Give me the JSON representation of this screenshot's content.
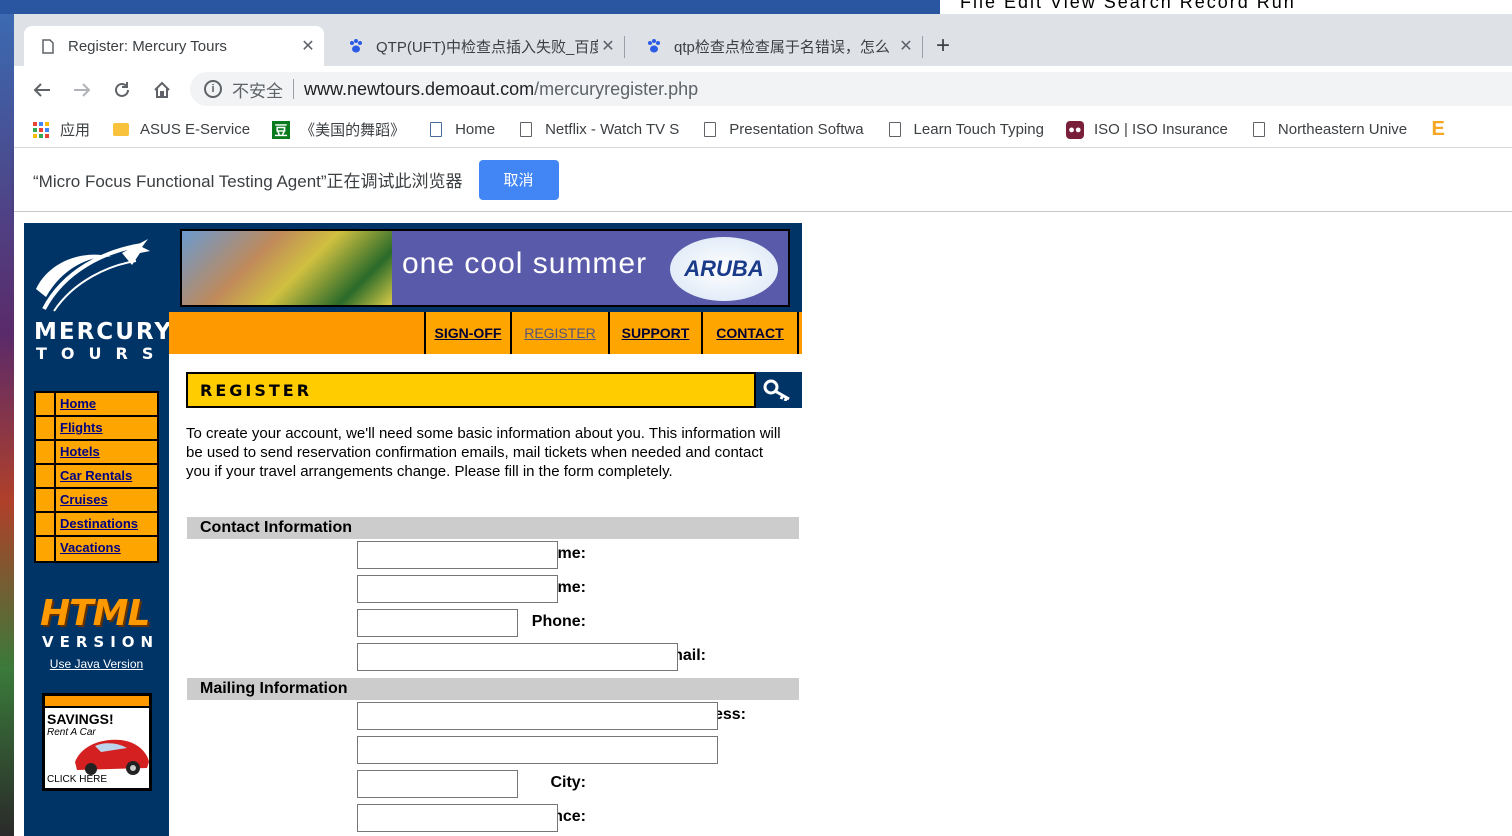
{
  "desktop": {
    "top_right_text": "File Edit View Search Record Run"
  },
  "browser": {
    "tabs": [
      {
        "title": "Register: Mercury Tours",
        "active": true,
        "icon": "page-icon"
      },
      {
        "title": "QTP(UFT)中检查点插入失败_百度",
        "active": false,
        "icon": "baidu-paw-icon"
      },
      {
        "title": "qtp检查点检查属于名错误，怎么",
        "active": false,
        "icon": "baidu-paw-icon"
      }
    ],
    "new_tab": "+",
    "address": {
      "security_label": "不安全",
      "host": "www.newtours.demoaut.com",
      "path": "/mercuryregister.php"
    },
    "bookmarks": [
      {
        "label": "应用",
        "icon": "apps-grid-icon"
      },
      {
        "label": "ASUS E-Service",
        "icon": "folder-icon"
      },
      {
        "label": "《美国的舞蹈》",
        "icon": "douban-icon"
      },
      {
        "label": "Home",
        "icon": "document-icon"
      },
      {
        "label": "Netflix - Watch TV S",
        "icon": "page-icon"
      },
      {
        "label": "Presentation Softwa",
        "icon": "page-icon"
      },
      {
        "label": "Learn Touch Typing",
        "icon": "page-icon"
      },
      {
        "label": "ISO | ISO Insurance",
        "icon": "iso-icon"
      },
      {
        "label": "Northeastern Unive",
        "icon": "page-icon"
      }
    ],
    "infobar": {
      "message": "“Micro Focus Functional Testing Agent”正在调试此浏览器",
      "cancel_label": "取消"
    }
  },
  "site": {
    "logo_line1": "MERCURY",
    "logo_line2": "TOURS",
    "side_nav": [
      "Home",
      "Flights",
      "Hotels",
      "Car Rentals",
      "Cruises",
      "Destinations",
      "Vacations"
    ],
    "html_version_line1": "HTML",
    "html_version_line2": "VERSION",
    "java_link": "Use Java Version",
    "savings_title": "SAVINGS!",
    "savings_sub": "Rent A Car",
    "savings_cta": "CLICK HERE",
    "banner_text": "one cool summer",
    "banner_brand": "ARUBA",
    "top_nav": [
      {
        "label": "SIGN-OFF",
        "current": false
      },
      {
        "label": "REGISTER",
        "current": true
      },
      {
        "label": "SUPPORT",
        "current": false
      },
      {
        "label": "CONTACT",
        "current": false
      }
    ],
    "page_heading": "REGISTER",
    "intro": "To create your account, we'll need some basic information about you. This information will be used to send reservation confirmation emails, mail tickets when needed and contact you if your travel arrangements change. Please fill in the form completely.",
    "sections": {
      "contact": "Contact Information",
      "mailing": "Mailing Information"
    },
    "fields": {
      "first_name": {
        "label": "First Name:",
        "value": ""
      },
      "last_name": {
        "label": "Last Name:",
        "value": ""
      },
      "phone": {
        "label": "Phone:",
        "value": ""
      },
      "email": {
        "label": "Email:",
        "value": ""
      },
      "address1": {
        "label": "Address:",
        "value": ""
      },
      "address2": {
        "label": "",
        "value": ""
      },
      "city": {
        "label": "City:",
        "value": ""
      },
      "state": {
        "label": "State/Province:",
        "value": ""
      }
    }
  }
}
